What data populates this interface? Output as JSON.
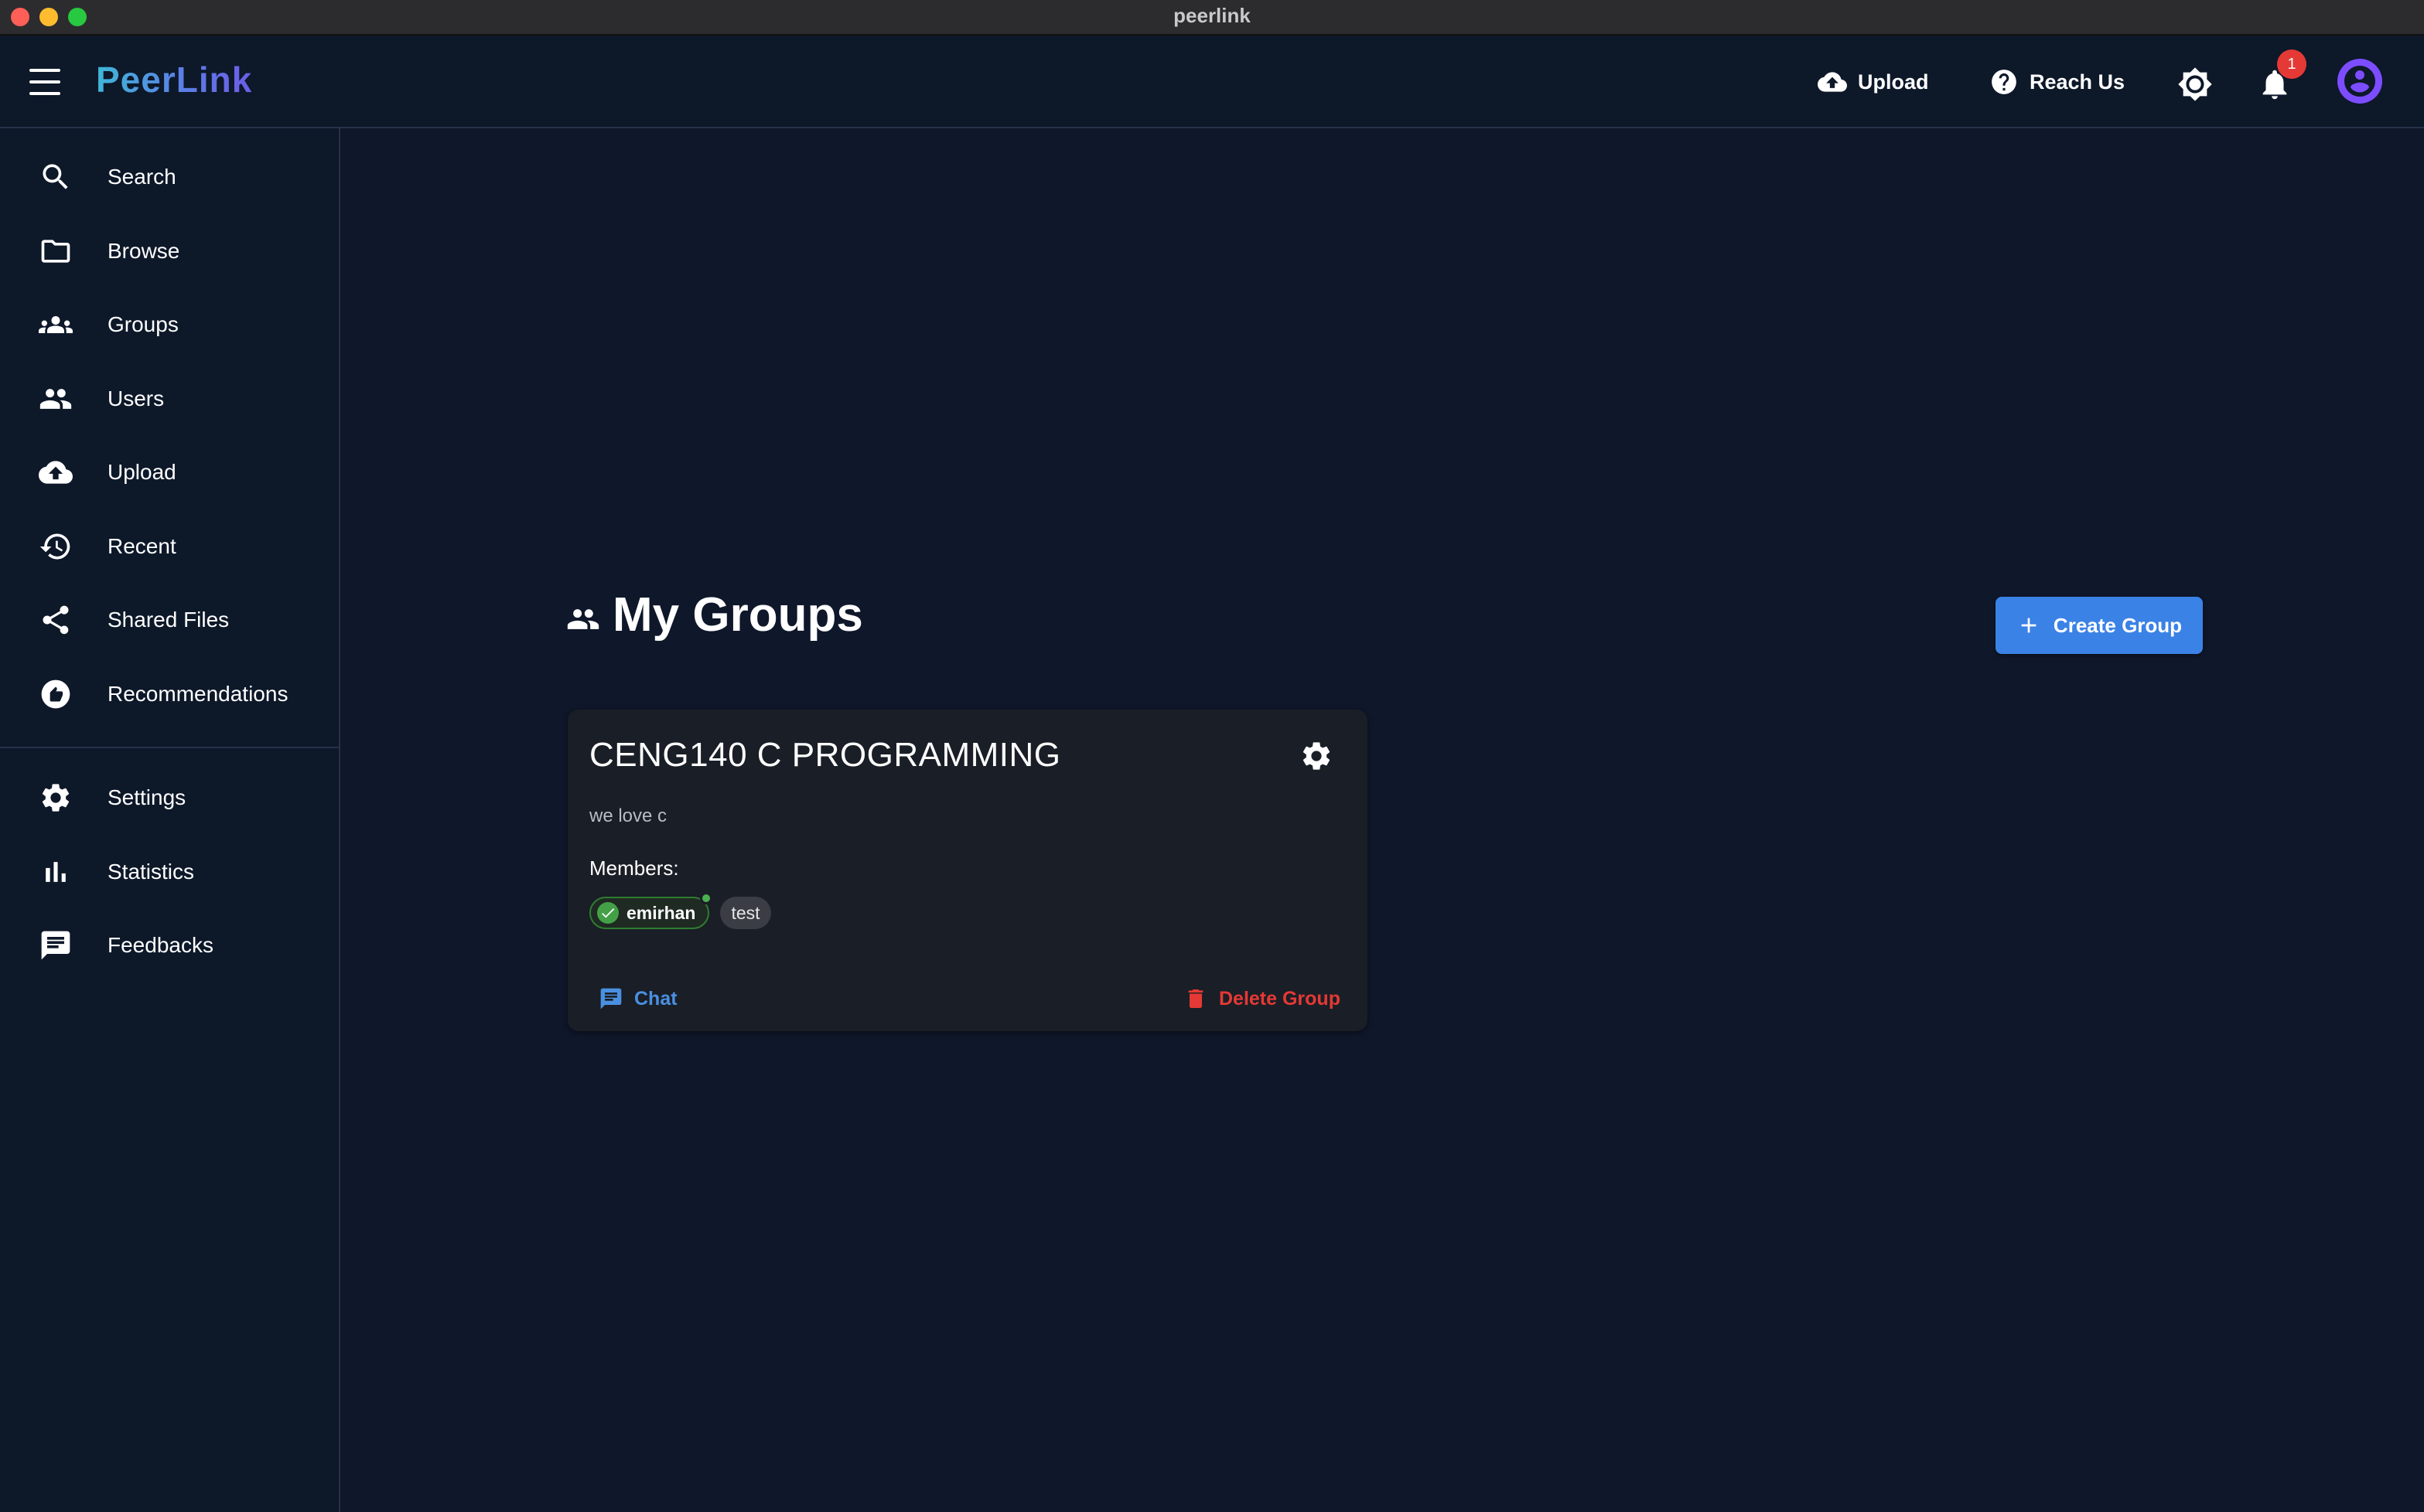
{
  "window": {
    "title": "peerlink"
  },
  "appbar": {
    "brand": "PeerLink",
    "upload_label": "Upload",
    "reach_label": "Reach Us",
    "notification_count": "1",
    "icons": [
      "menu-icon",
      "cloud-upload-icon",
      "help-icon",
      "theme-toggle-icon",
      "bell-icon",
      "account-circle-icon"
    ]
  },
  "sidebar": {
    "items": [
      {
        "label": "Search",
        "icon": "search-icon"
      },
      {
        "label": "Browse",
        "icon": "folder-icon"
      },
      {
        "label": "Groups",
        "icon": "groups-icon"
      },
      {
        "label": "Users",
        "icon": "people-icon"
      },
      {
        "label": "Upload",
        "icon": "cloud-upload-icon"
      },
      {
        "label": "Recent",
        "icon": "history-icon"
      },
      {
        "label": "Shared Files",
        "icon": "share-icon"
      },
      {
        "label": "Recommendations",
        "icon": "thumb-up-icon"
      }
    ],
    "secondary_items": [
      {
        "label": "Settings",
        "icon": "gear-icon"
      },
      {
        "label": "Statistics",
        "icon": "bar-chart-icon"
      },
      {
        "label": "Feedbacks",
        "icon": "feedback-icon"
      }
    ]
  },
  "main": {
    "title": "My Groups",
    "create_button": "Create Group",
    "groups": [
      {
        "name": "CENG140 C PROGRAMMING",
        "description": "we love c",
        "members_label": "Members:",
        "members": [
          {
            "name": "emirhan",
            "verified": true,
            "online": true
          },
          {
            "name": "test",
            "verified": false,
            "online": false
          }
        ],
        "chat_label": "Chat",
        "delete_label": "Delete Group"
      }
    ]
  },
  "colors": {
    "background": "#0f172a",
    "surface": "#0d1829",
    "card": "#1a1e26",
    "accent": "#3b82e6",
    "danger": "#e53935",
    "success": "#43a047",
    "avatar": "#7c4dff"
  }
}
